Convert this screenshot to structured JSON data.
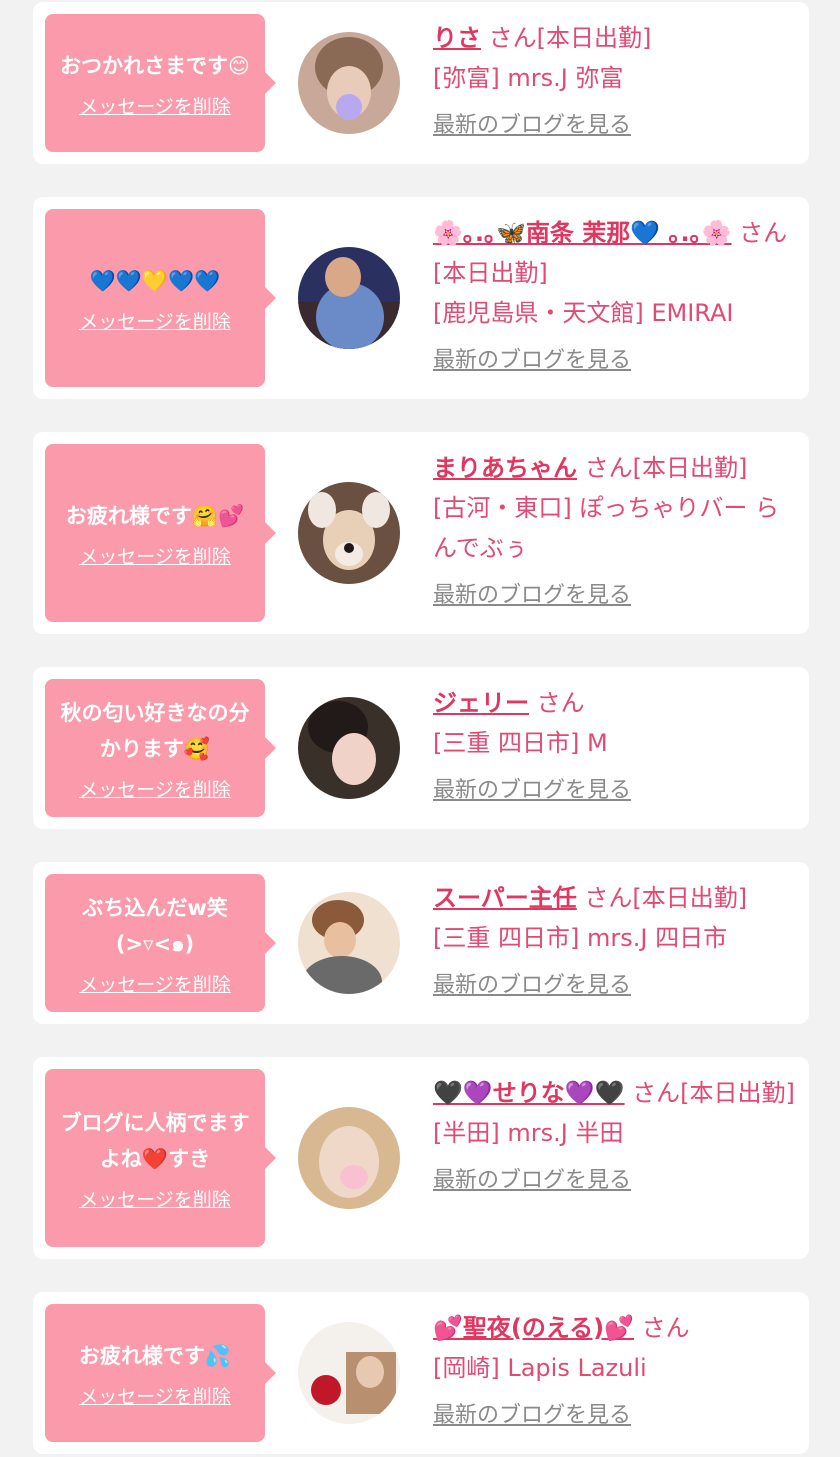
{
  "favorites": [
    {
      "message": "おつかれさまです😊",
      "delete_label": "メッセージを削除",
      "name": "りさ",
      "suffix": "さん[本日出勤]",
      "shop": "[弥富] mrs.J 弥富",
      "blog_link": "最新のブログを見る",
      "avatar_colors": [
        "#c8a898",
        "#8a6a55"
      ]
    },
    {
      "message": "💙💙💛💙💙",
      "delete_label": "メッセージを削除",
      "name": "🌸｡.｡🦋南条 茉那💙 ｡.｡🌸",
      "suffix": "さん[本日出勤]",
      "shop": "[鹿児島県・天文館] EMIRAI",
      "blog_link": "最新のブログを見る",
      "avatar_colors": [
        "#2a3060",
        "#6a8ac8"
      ]
    },
    {
      "message": "お疲れ様です🤗💕",
      "delete_label": "メッセージを削除",
      "name": "まりあちゃん",
      "suffix": "さん[本日出勤]",
      "shop": "[古河・東口] ぽっちゃりバー らんでぶぅ",
      "blog_link": "最新のブログを見る",
      "avatar_colors": [
        "#6a5040",
        "#e8d8c8"
      ]
    },
    {
      "message": "秋の匂い好きなの分かります🥰",
      "delete_label": "メッセージを削除",
      "name": "ジェリー",
      "suffix": "さん",
      "shop": "[三重 四日市] M",
      "blog_link": "最新のブログを見る",
      "avatar_colors": [
        "#3a302a",
        "#e8c8c0"
      ]
    },
    {
      "message": "ぶち込んだw笑 (>▿<๑)",
      "delete_label": "メッセージを削除",
      "name": "スーパー主任",
      "suffix": "さん[本日出勤]",
      "shop": "[三重 四日市] mrs.J 四日市",
      "blog_link": "最新のブログを見る",
      "avatar_colors": [
        "#f0e0d0",
        "#8a5a3a"
      ]
    },
    {
      "message": "ブログに人柄でますよね❤️すき",
      "delete_label": "メッセージを削除",
      "name": "🖤💜せりな💜🖤",
      "suffix": "さん[本日出勤]",
      "shop": "[半田] mrs.J 半田",
      "blog_link": "最新のブログを見る",
      "avatar_colors": [
        "#d8b890",
        "#f8d0d8"
      ]
    },
    {
      "message": "お疲れ様です💦",
      "delete_label": "メッセージを削除",
      "name": "💕聖夜(のえる)💕",
      "suffix": "さん",
      "shop": "[岡崎] Lapis Lazuli",
      "blog_link": "最新のブログを見る",
      "avatar_colors": [
        "#f4f0ec",
        "#c01828"
      ]
    }
  ]
}
